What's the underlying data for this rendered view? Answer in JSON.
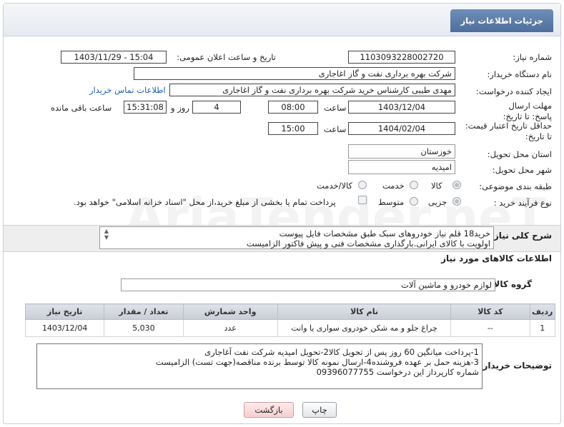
{
  "tab": {
    "title": "جزئیات اطلاعات نیاز"
  },
  "fields": {
    "need_number_label": "شماره نیاز:",
    "need_number": "1103093228002720",
    "announce_label": "تاریخ و ساعت اعلان عمومی:",
    "announce_value": "1403/11/29 - 15:04",
    "buyer_label": "نام دستگاه خریدار:",
    "buyer_value": "شرکت بهره برداری نفت و گاز اغاجاری",
    "creator_label": "ایجاد کننده درخواست:",
    "creator_value": "مهدی طیبی کارشناس خرید شرکت بهره برداری نفت و گاز اغاجاری",
    "contact_link": "اطلاعات تماس خریدار",
    "deadline_label": "مهلت ارسال پاسخ: تا تاریخ:",
    "deadline_date": "1403/12/04",
    "time_label": "ساعت",
    "deadline_time": "08:00",
    "days_value": "4",
    "days_label": "روز و",
    "remaining_time": "15:31:08",
    "remaining_label": "ساعت باقی مانده",
    "validity_label": "حداقل تاریخ اعتبار قیمت: تا تاریخ:",
    "validity_date": "1404/02/04",
    "validity_time_label": "ساعت",
    "validity_time": "15:00",
    "province_label": "استان محل تحویل:",
    "province_value": "خوزستان",
    "city_label": "شهر محل تحویل:",
    "city_value": "امیدیه",
    "category_label": "طبقه بندی موضوعی:",
    "category_options": [
      "کالا",
      "خدمت",
      "کالا/خدمت"
    ],
    "category_selected": "کالا",
    "process_label": "نوع فرآیند خرید :",
    "process_options": [
      "جزیی",
      "متوسط"
    ],
    "process_selected": "جزیی",
    "payment_note": "پرداخت تمام یا بخشی از مبلغ خرید،از محل \"اسناد خزانه اسلامی\" خواهد بود."
  },
  "summary": {
    "label": "شرح کلی نیاز:",
    "line1": "خرید18 قلم نیاز خودروهای سبک طبق مشخصات فایل پیوست",
    "line2": "اولویت با کالای ایرانی.بارگذاری مشخصات فنی و پیش فاکتور الزامیست"
  },
  "goods_section": {
    "title": "اطلاعات کالاهای مورد نیاز"
  },
  "goods_group": {
    "label": "گروه کالا:",
    "value": "لوازم خودرو و ماشین آلات"
  },
  "table": {
    "headers": [
      "ردیف",
      "کد کالا",
      "نام کالا",
      "واحد شمارش",
      "تعداد / مقدار",
      "تاریخ نیاز"
    ],
    "rows": [
      [
        "1",
        "--",
        "چراغ جلو و مه شکن خودروی سواری یا وانت",
        "عدد",
        "5,030",
        "1403/12/04"
      ]
    ]
  },
  "buyer_notes": {
    "label": "توضیحات خریدار:",
    "line1": "1-پرداخت میانگین 60 روز پس از تحویل کالا2-تحویل امیدیه شرکت نفت آغاجاری",
    "line2": "3-هزینه حمل بر عهده فروشنده4-ارسال نمونه کالا توسط برنده مناقصه(جهت تست) الزامیست",
    "line3": "شماره کارپرداز این درخواست 09396077755"
  },
  "buttons": {
    "print": "چاپ",
    "back": "بازگشت"
  },
  "watermark": "AriaTender.neT"
}
